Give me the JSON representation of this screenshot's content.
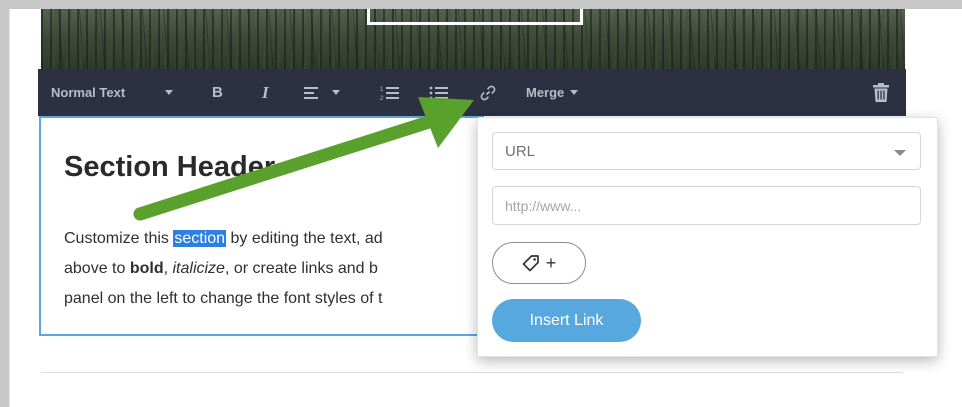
{
  "toolbar": {
    "text_style": "Normal Text",
    "bold": "B",
    "italic": "I",
    "merge": "Merge",
    "icons": [
      "bold-icon",
      "italic-icon",
      "align-left-icon",
      "ordered-list-icon",
      "unordered-list-icon",
      "link-icon",
      "trash-icon"
    ]
  },
  "editor": {
    "section_header": "Section Header",
    "line1_before": "Customize this ",
    "line1_selected": "section",
    "line1_after": " by editing the text, ad",
    "line2_a": "above to ",
    "line2_bold": "bold",
    "line2_b": ", ",
    "line2_italic": "italicize",
    "line2_c": ", or create links and b",
    "line3": "panel on the left to change the font styles of t"
  },
  "link_popup": {
    "link_type": "URL",
    "url_placeholder": "http://www...",
    "tag_plus": "+",
    "insert_label": "Insert Link"
  },
  "colors": {
    "toolbar_bg": "#2c3041",
    "accent_blue": "#58a8e0",
    "selection": "#2d7fe3",
    "annotation_arrow": "#5aa02c"
  }
}
